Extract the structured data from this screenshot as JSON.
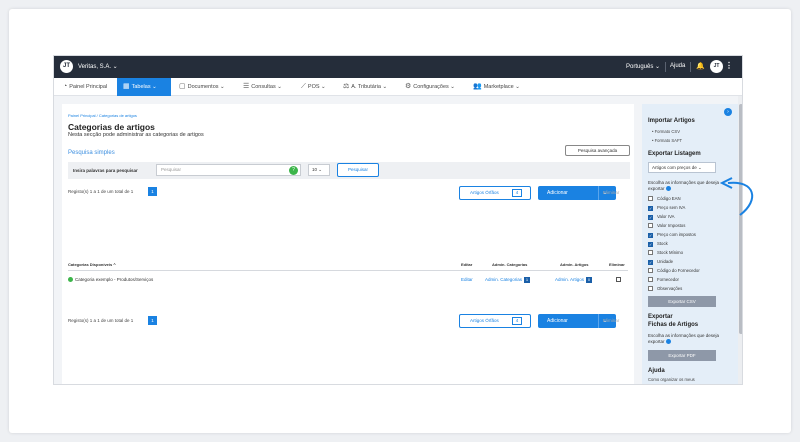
{
  "topbar": {
    "logo": "JT",
    "company": "Veritas, S.A. ⌄",
    "language": "Português ⌄",
    "help": "Ajuda",
    "avatar": "JT"
  },
  "nav": [
    {
      "label": "Painel Principal",
      "icon": "gauge-icon"
    },
    {
      "label": "Tabelas ⌄",
      "icon": "table-icon",
      "active": true
    },
    {
      "label": "Documentos ⌄",
      "icon": "document-icon"
    },
    {
      "label": "Consultas ⌄",
      "icon": "list-icon"
    },
    {
      "label": "POS ⌄",
      "icon": "pos-icon"
    },
    {
      "label": "A. Tributária ⌄",
      "icon": "scale-icon"
    },
    {
      "label": "Configurações ⌄",
      "icon": "sliders-icon"
    },
    {
      "label": "Marketplace ⌄",
      "icon": "users-icon"
    }
  ],
  "page": {
    "breadcrumb": "Painel Principal  /  Categorias de artigos",
    "title": "Categorias de artigos",
    "subtitle": "Nesta secção pode administrar as categorias de artigos",
    "advanced_search": "Pesquisa avançada",
    "simple_search": "Pesquisa simples",
    "search_label": "Insira palavras para pesquisar",
    "search_placeholder": "Pesquisar",
    "page_size": "10 ⌄",
    "search_button": "Pesquisar",
    "records": "Registo(s) 1 a 1 de um total de 1",
    "page_number": "1",
    "orphans_label": "Artigos Órfãos",
    "orphans_count": "4",
    "add_label": "Adicionar",
    "delete_label": "Eliminar"
  },
  "table": {
    "headers": {
      "category": "Categorias Disponíveis  ^",
      "editor": "Editar",
      "admin_cat": "Admin. Categorias",
      "admin_art": "Admin. Artigos",
      "delete": "Eliminar"
    },
    "rows": [
      {
        "category": "Categoria exemplo - Produtos/Serviços",
        "edit": "Editar",
        "admin_cat": "Admin. Categorias",
        "admin_cat_count": "1",
        "admin_art": "Admin. Artigos",
        "admin_art_count": "0"
      }
    ]
  },
  "sidebar": {
    "import_title": "Importar Artigos",
    "import_csv": "• Formato CSV",
    "import_saft": "• Formato SAFT",
    "export_title": "Exportar Listagem",
    "export_select": "Artigos com preços de ⌄",
    "export_note": "Escolha as informações que deseja exportar",
    "fields": [
      {
        "label": "Código EAN",
        "checked": false
      },
      {
        "label": "Preço sem IVA",
        "checked": true
      },
      {
        "label": "Valor IVA",
        "checked": true
      },
      {
        "label": "Valor Impostos",
        "checked": false
      },
      {
        "label": "Preço com impostos",
        "checked": true
      },
      {
        "label": "Stock",
        "checked": true
      },
      {
        "label": "Stock Mínimo",
        "checked": false
      },
      {
        "label": "Unidade",
        "checked": true
      },
      {
        "label": "Código do Fornecedor",
        "checked": false
      },
      {
        "label": "Fornecedor",
        "checked": false
      },
      {
        "label": "Observações",
        "checked": false
      }
    ],
    "export_csv": "Exportar CSV",
    "fichas_title1": "Exportar",
    "fichas_title2": "Fichas de Artigos",
    "fichas_note": "Escolha as informações que deseja exportar",
    "export_pdf": "Exportar PDF",
    "help_title": "Ajuda",
    "help_text": "Como organizar os meus"
  }
}
